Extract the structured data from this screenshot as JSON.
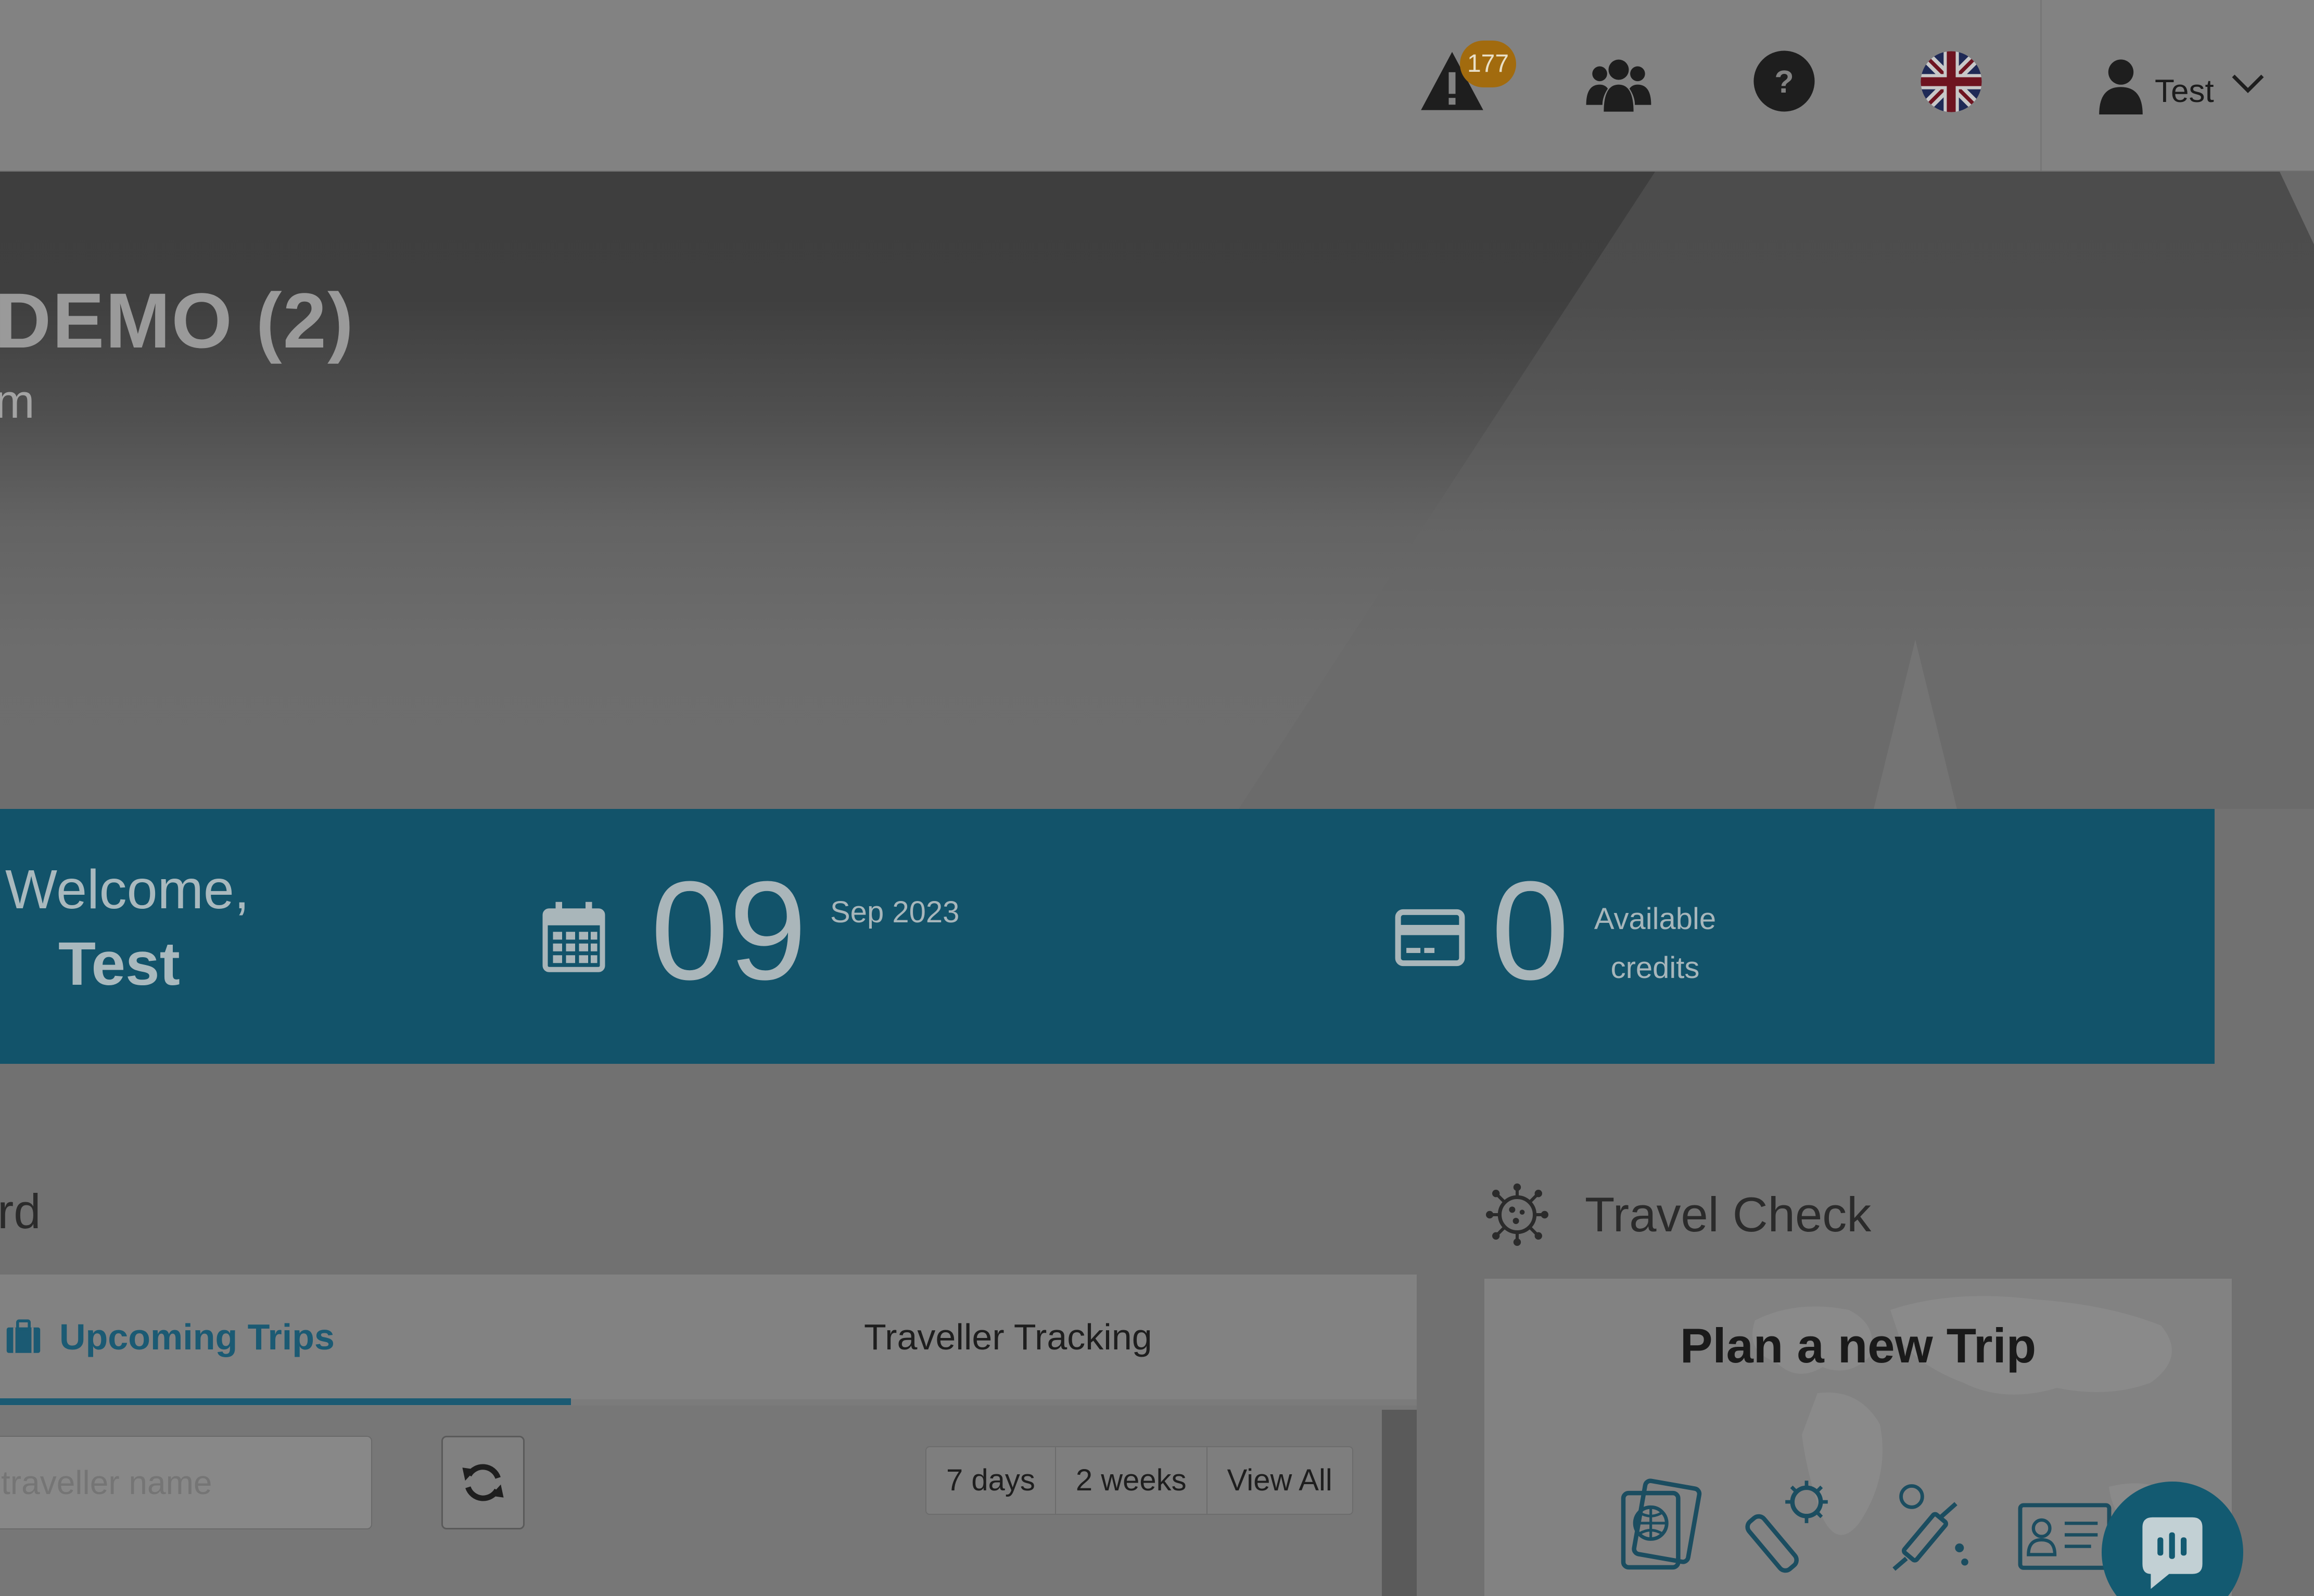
{
  "topbar": {
    "alerts_count": "177",
    "user_name": "Test",
    "icons": [
      "alert-triangle-icon",
      "team-icon",
      "help-icon",
      "uk-flag-icon",
      "user-icon",
      "chevron-down-icon"
    ]
  },
  "hero": {
    "title": "DEMO (2)",
    "subtitle": "m"
  },
  "banner": {
    "welcome_line1": "Welcome,",
    "welcome_name": "Test",
    "day": "09",
    "month_year": "Sep 2023",
    "credits_value": "0",
    "credits_label_line1": "Available",
    "credits_label_line2": "credits"
  },
  "dashboard": {
    "title_fragment": "rd",
    "tabs": [
      {
        "label": "Upcoming Trips",
        "active": true
      },
      {
        "label": "Traveller Tracking",
        "active": false
      }
    ],
    "search_placeholder": "traveller name",
    "ranges": [
      "7 days",
      "2 weeks",
      "View All"
    ]
  },
  "travel_check": {
    "title": "Travel Check",
    "plan_title": "Plan a new Trip",
    "icons": [
      "passport-icon",
      "covid-test-icon",
      "vaccine-icon",
      "id-card-icon"
    ]
  },
  "colors": {
    "banner": "#12536a",
    "accent": "#1b5a73",
    "badge": "#a26b0e"
  }
}
